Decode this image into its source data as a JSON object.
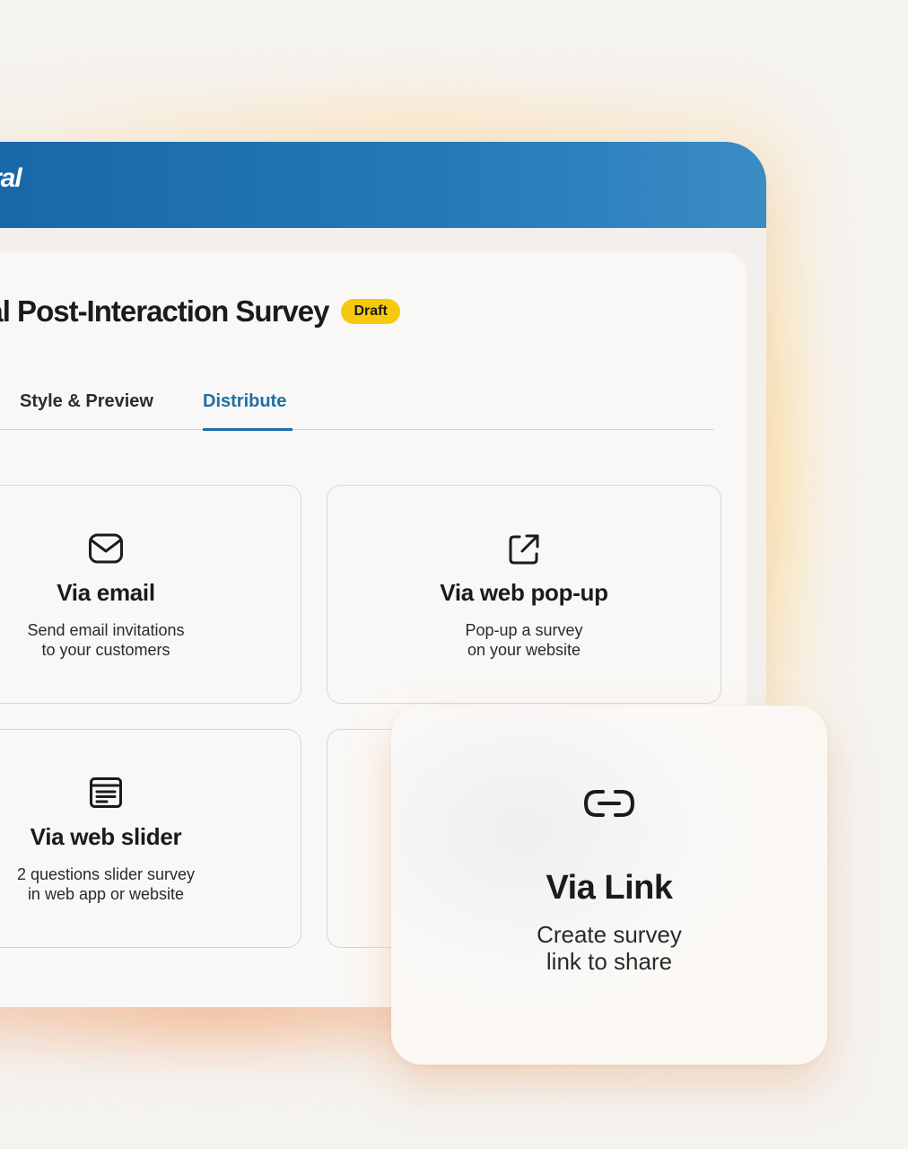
{
  "app": {
    "brand_fragment": "ral"
  },
  "survey": {
    "title": "rical Post-Interaction Survey",
    "status_badge": "Draft"
  },
  "tabs": [
    {
      "label": "Style & Preview",
      "active": false
    },
    {
      "label": "Distribute",
      "active": true
    }
  ],
  "options": [
    {
      "title": "Via email",
      "description": "Send email invitations\nto your customers",
      "icon": "envelope-icon"
    },
    {
      "title": "Via web pop-up",
      "description": "Pop-up a survey\non your website",
      "icon": "external-link-icon"
    },
    {
      "title": "Via web slider",
      "description": "2 questions slider survey\nin web app or website",
      "icon": "slider-form-icon"
    }
  ],
  "link_option": {
    "title": "Via Link",
    "description": "Create survey\nlink to share",
    "icon": "link-icon"
  },
  "colors": {
    "header_blue": "#1766a8",
    "accent_blue": "#1f6ea8",
    "badge_yellow": "#f6c90e"
  }
}
